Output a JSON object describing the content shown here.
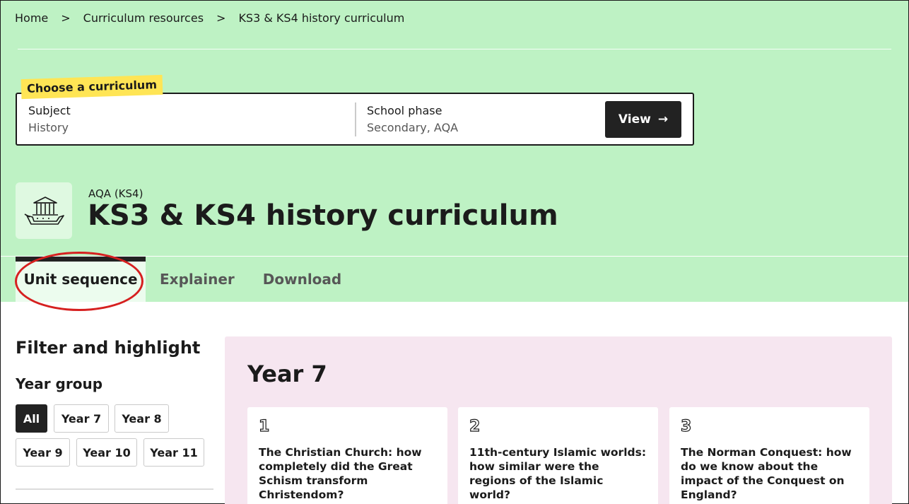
{
  "breadcrumb": {
    "items": [
      "Home",
      "Curriculum resources",
      "KS3 & KS4 history curriculum"
    ],
    "separator": ">"
  },
  "selector": {
    "badge": "Choose a curriculum",
    "subject_label": "Subject",
    "subject_value": "History",
    "phase_label": "School phase",
    "phase_value": "Secondary, AQA",
    "view_label": "View",
    "view_arrow": "→"
  },
  "header": {
    "eyebrow": "AQA (KS4)",
    "title": "KS3 & KS4 history curriculum",
    "icon": "history-building-icon"
  },
  "tabs": [
    {
      "label": "Unit sequence",
      "active": true
    },
    {
      "label": "Explainer",
      "active": false
    },
    {
      "label": "Download",
      "active": false
    }
  ],
  "filters": {
    "title": "Filter and highlight",
    "year_group_title": "Year group",
    "chips": [
      "All",
      "Year 7",
      "Year 8",
      "Year 9",
      "Year 10",
      "Year 11"
    ],
    "selected": "All"
  },
  "year_panel": {
    "title": "Year 7",
    "units": [
      {
        "number": "1",
        "title": "The Christian Church: how completely did the Great Schism transform Christendom?"
      },
      {
        "number": "2",
        "title": "11th-century Islamic worlds: how similar were the regions of the Islamic world?"
      },
      {
        "number": "3",
        "title": "The Norman Conquest: how do we know about the impact of the Conquest on England?"
      }
    ]
  },
  "colors": {
    "band": "#bef2c4",
    "badge": "#ffe555",
    "panel": "#f6e6f0",
    "highlight_circle": "#d62020",
    "dark": "#222222"
  }
}
